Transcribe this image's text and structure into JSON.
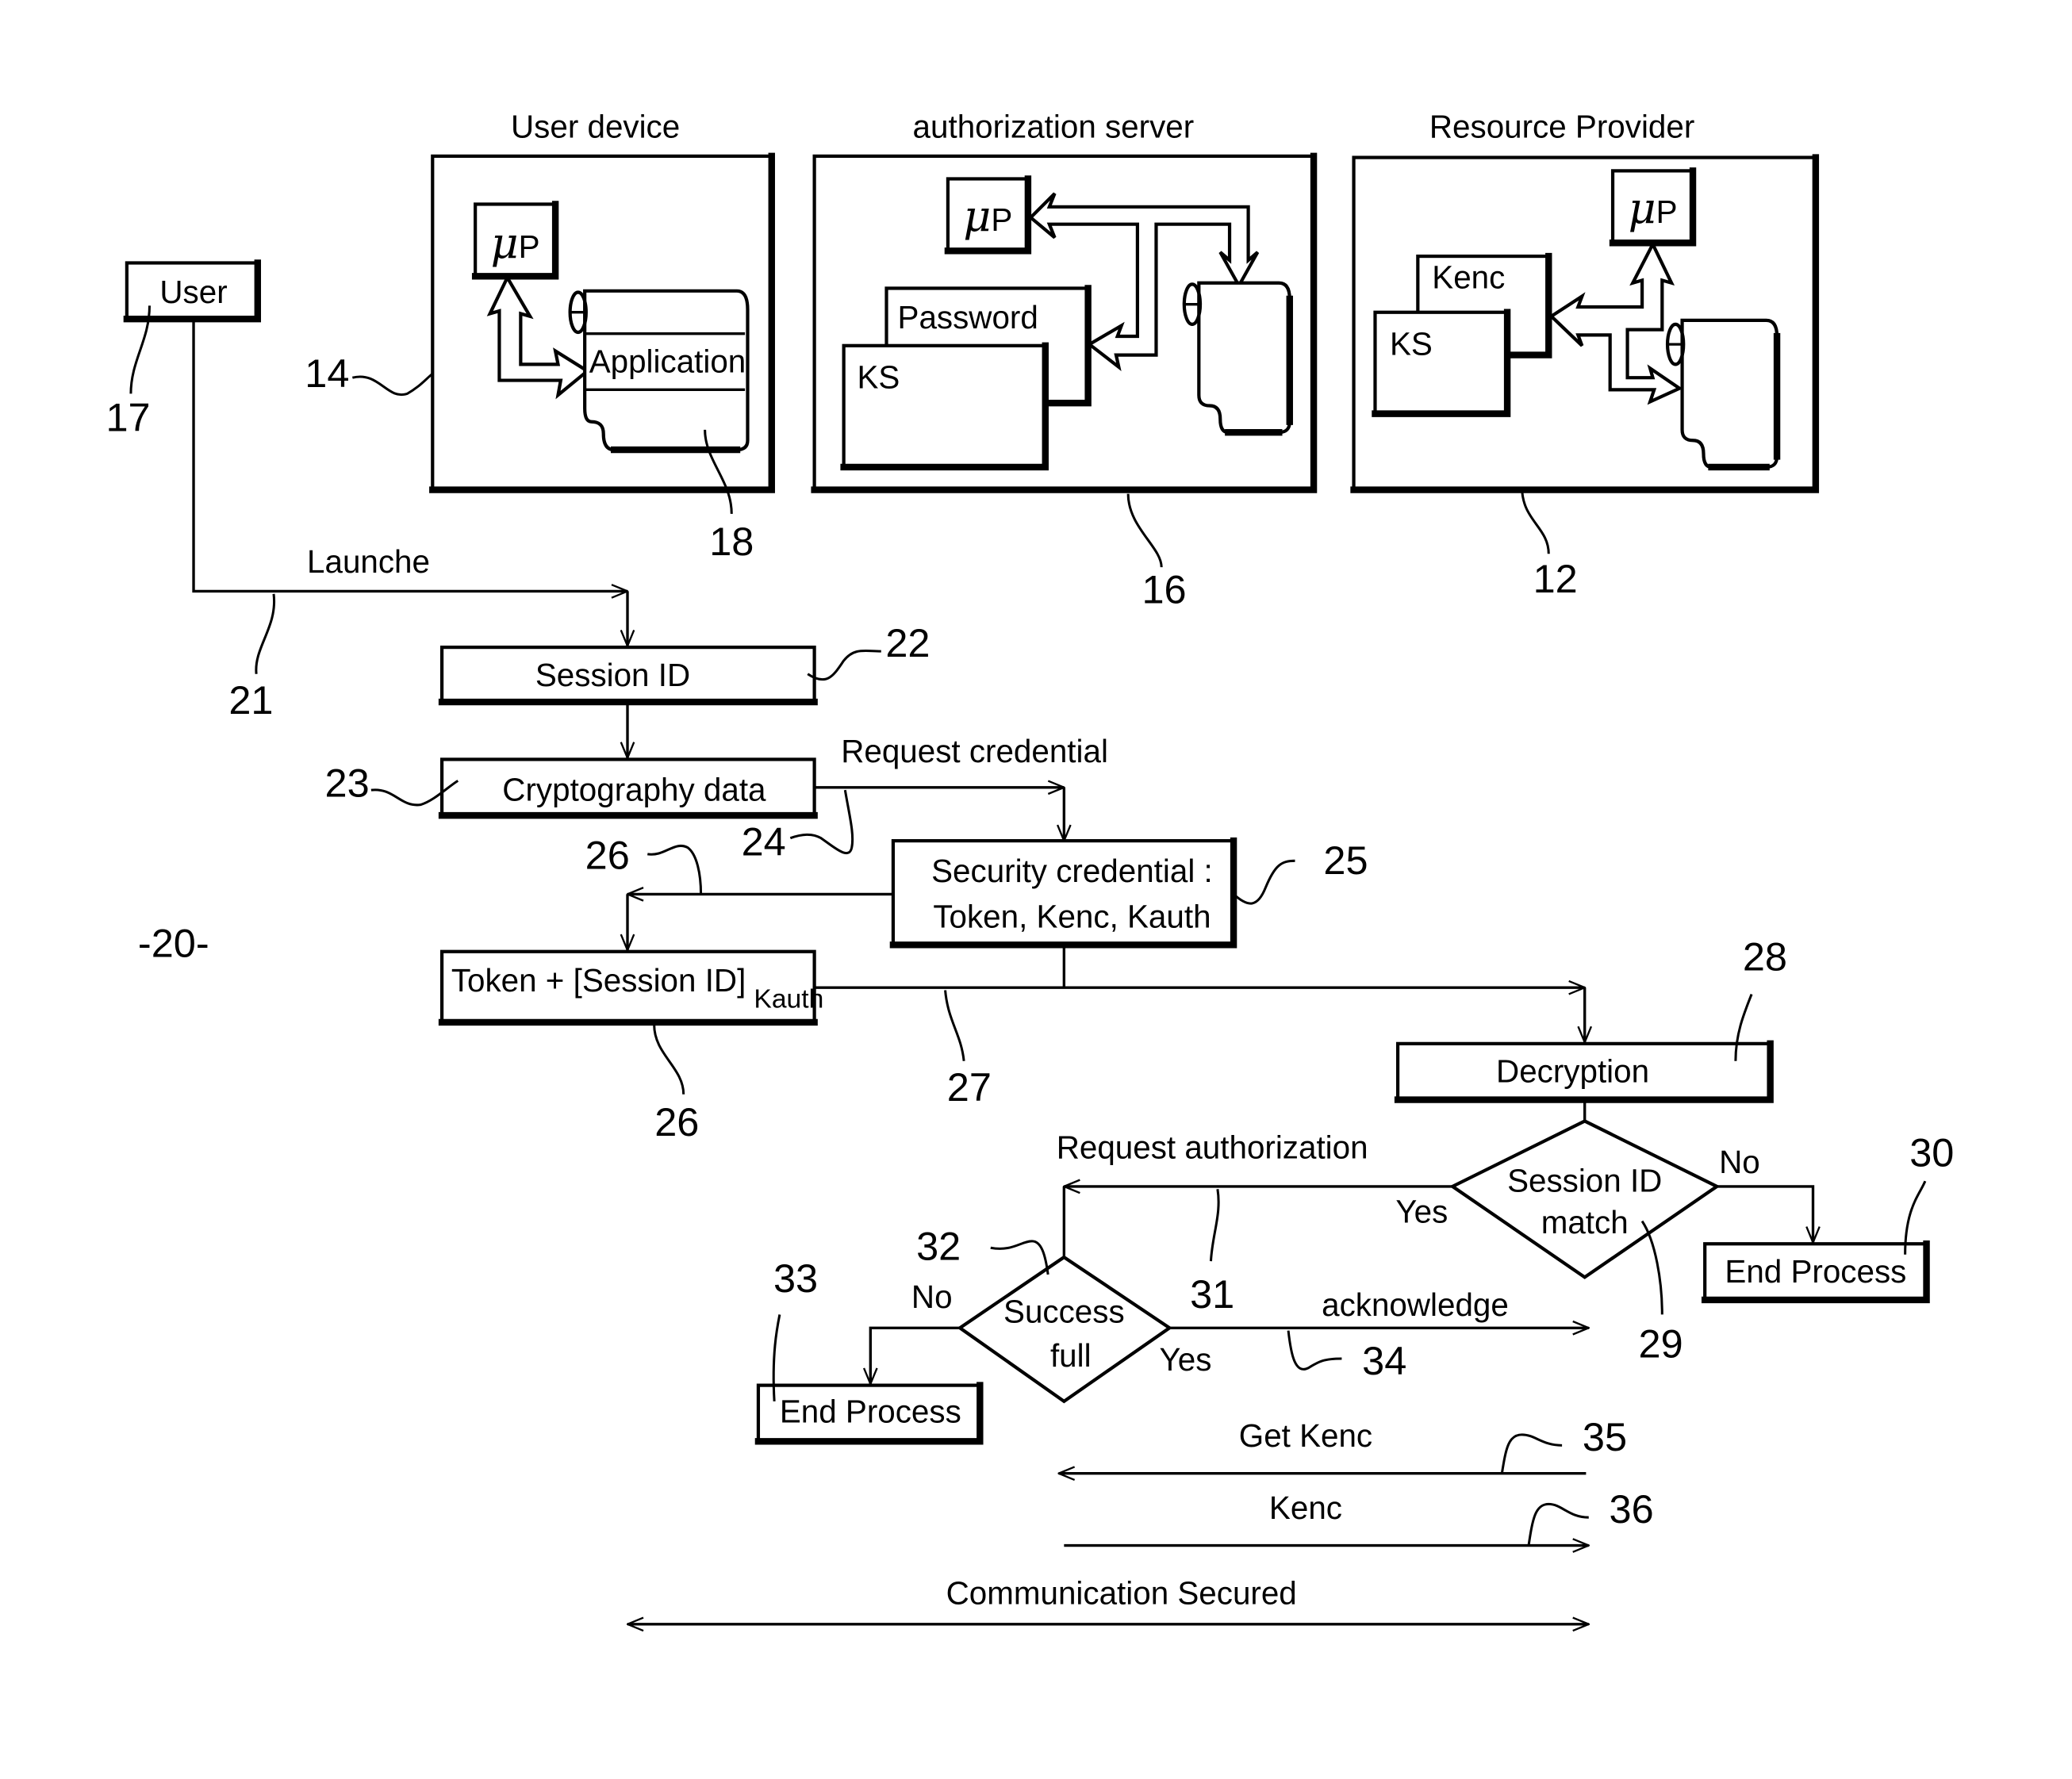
{
  "figure": {
    "label": "-20-",
    "colors": {
      "ink": "#000000",
      "paper": "#ffffff"
    }
  },
  "entities": {
    "user": {
      "label": "User",
      "ref": "17"
    },
    "user_device": {
      "title": "User device",
      "ref": "14",
      "processor": "P",
      "processor_prefix": "μ",
      "application": "Application",
      "application_ref": "18"
    },
    "authorization_server": {
      "title": "authorization server",
      "ref": "16",
      "processor": "P",
      "processor_prefix": "μ",
      "password": "Password",
      "keystore": "KS"
    },
    "resource_provider": {
      "title": "Resource Provider",
      "ref": "12",
      "processor": "P",
      "processor_prefix": "μ",
      "kenc": "Kenc",
      "keystore": "KS"
    }
  },
  "flow": {
    "launch": {
      "label": "Launche",
      "ref": "21"
    },
    "session_id": {
      "label": "Session ID",
      "ref": "22"
    },
    "crypto_data": {
      "label": "Cryptography data",
      "ref": "23"
    },
    "request_credential": {
      "label": "Request credential",
      "ref": "24"
    },
    "security_credential": {
      "line1": "Security credential :",
      "line2": "Token, Kenc, Kauth",
      "ref": "25"
    },
    "token_box": {
      "label": "Token + [Session ID]",
      "subscript": "Kauth",
      "ref": "26",
      "arrow_ref": "26"
    },
    "send_token": {
      "ref": "27"
    },
    "decryption": {
      "label": "Decryption",
      "ref": "28"
    },
    "session_match": {
      "line1": "Session ID",
      "line2": "match",
      "ref": "29",
      "yes": "Yes",
      "no": "No"
    },
    "end_process_1": {
      "label": "End Process",
      "ref": "30"
    },
    "request_authorization": {
      "label": "Request authorization",
      "ref": "31"
    },
    "successful": {
      "line1": "Success",
      "line2": "full",
      "ref": "32",
      "yes": "Yes",
      "no": "No"
    },
    "end_process_2": {
      "label": "End Process",
      "ref": "33"
    },
    "acknowledge": {
      "label": "acknowledge",
      "ref": "34"
    },
    "get_kenc": {
      "label": "Get Kenc",
      "ref": "35"
    },
    "kenc": {
      "label": "Kenc",
      "ref": "36"
    },
    "communication": {
      "label": "Communication Secured"
    }
  }
}
